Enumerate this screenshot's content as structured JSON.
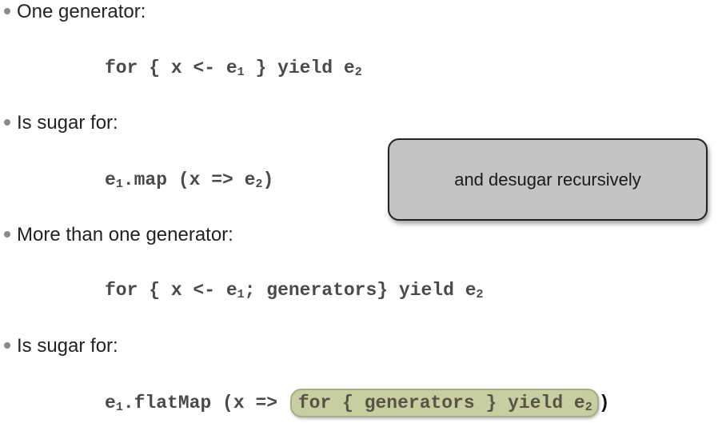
{
  "slide": {
    "bullet1": "One generator:",
    "code1": {
      "a": "for { x <- e",
      "a_sub": "1",
      "b": " } yield e",
      "b_sub": "2"
    },
    "bullet2": "Is sugar for:",
    "code2": {
      "a": "e",
      "a_sub": "1",
      "b": ".map (x => e",
      "b_sub": "2",
      "c": ")"
    },
    "bullet3": "More than one generator:",
    "code3": {
      "a": "for { x <- e",
      "a_sub": "1",
      "b": "; generators} yield e",
      "b_sub": "2"
    },
    "bullet4": "Is sugar for:",
    "code4": {
      "a": "e",
      "a_sub": "1",
      "b": ".flatMap (x => ",
      "highlight": "for { generators } yield e",
      "highlight_sub": "2",
      "c": ")"
    },
    "callout": "and desugar recursively"
  },
  "colors": {
    "callout_fill": "#c4c4c4",
    "highlight_fill": "#c9cda2",
    "bullet_dot": "#8a8a8a"
  }
}
